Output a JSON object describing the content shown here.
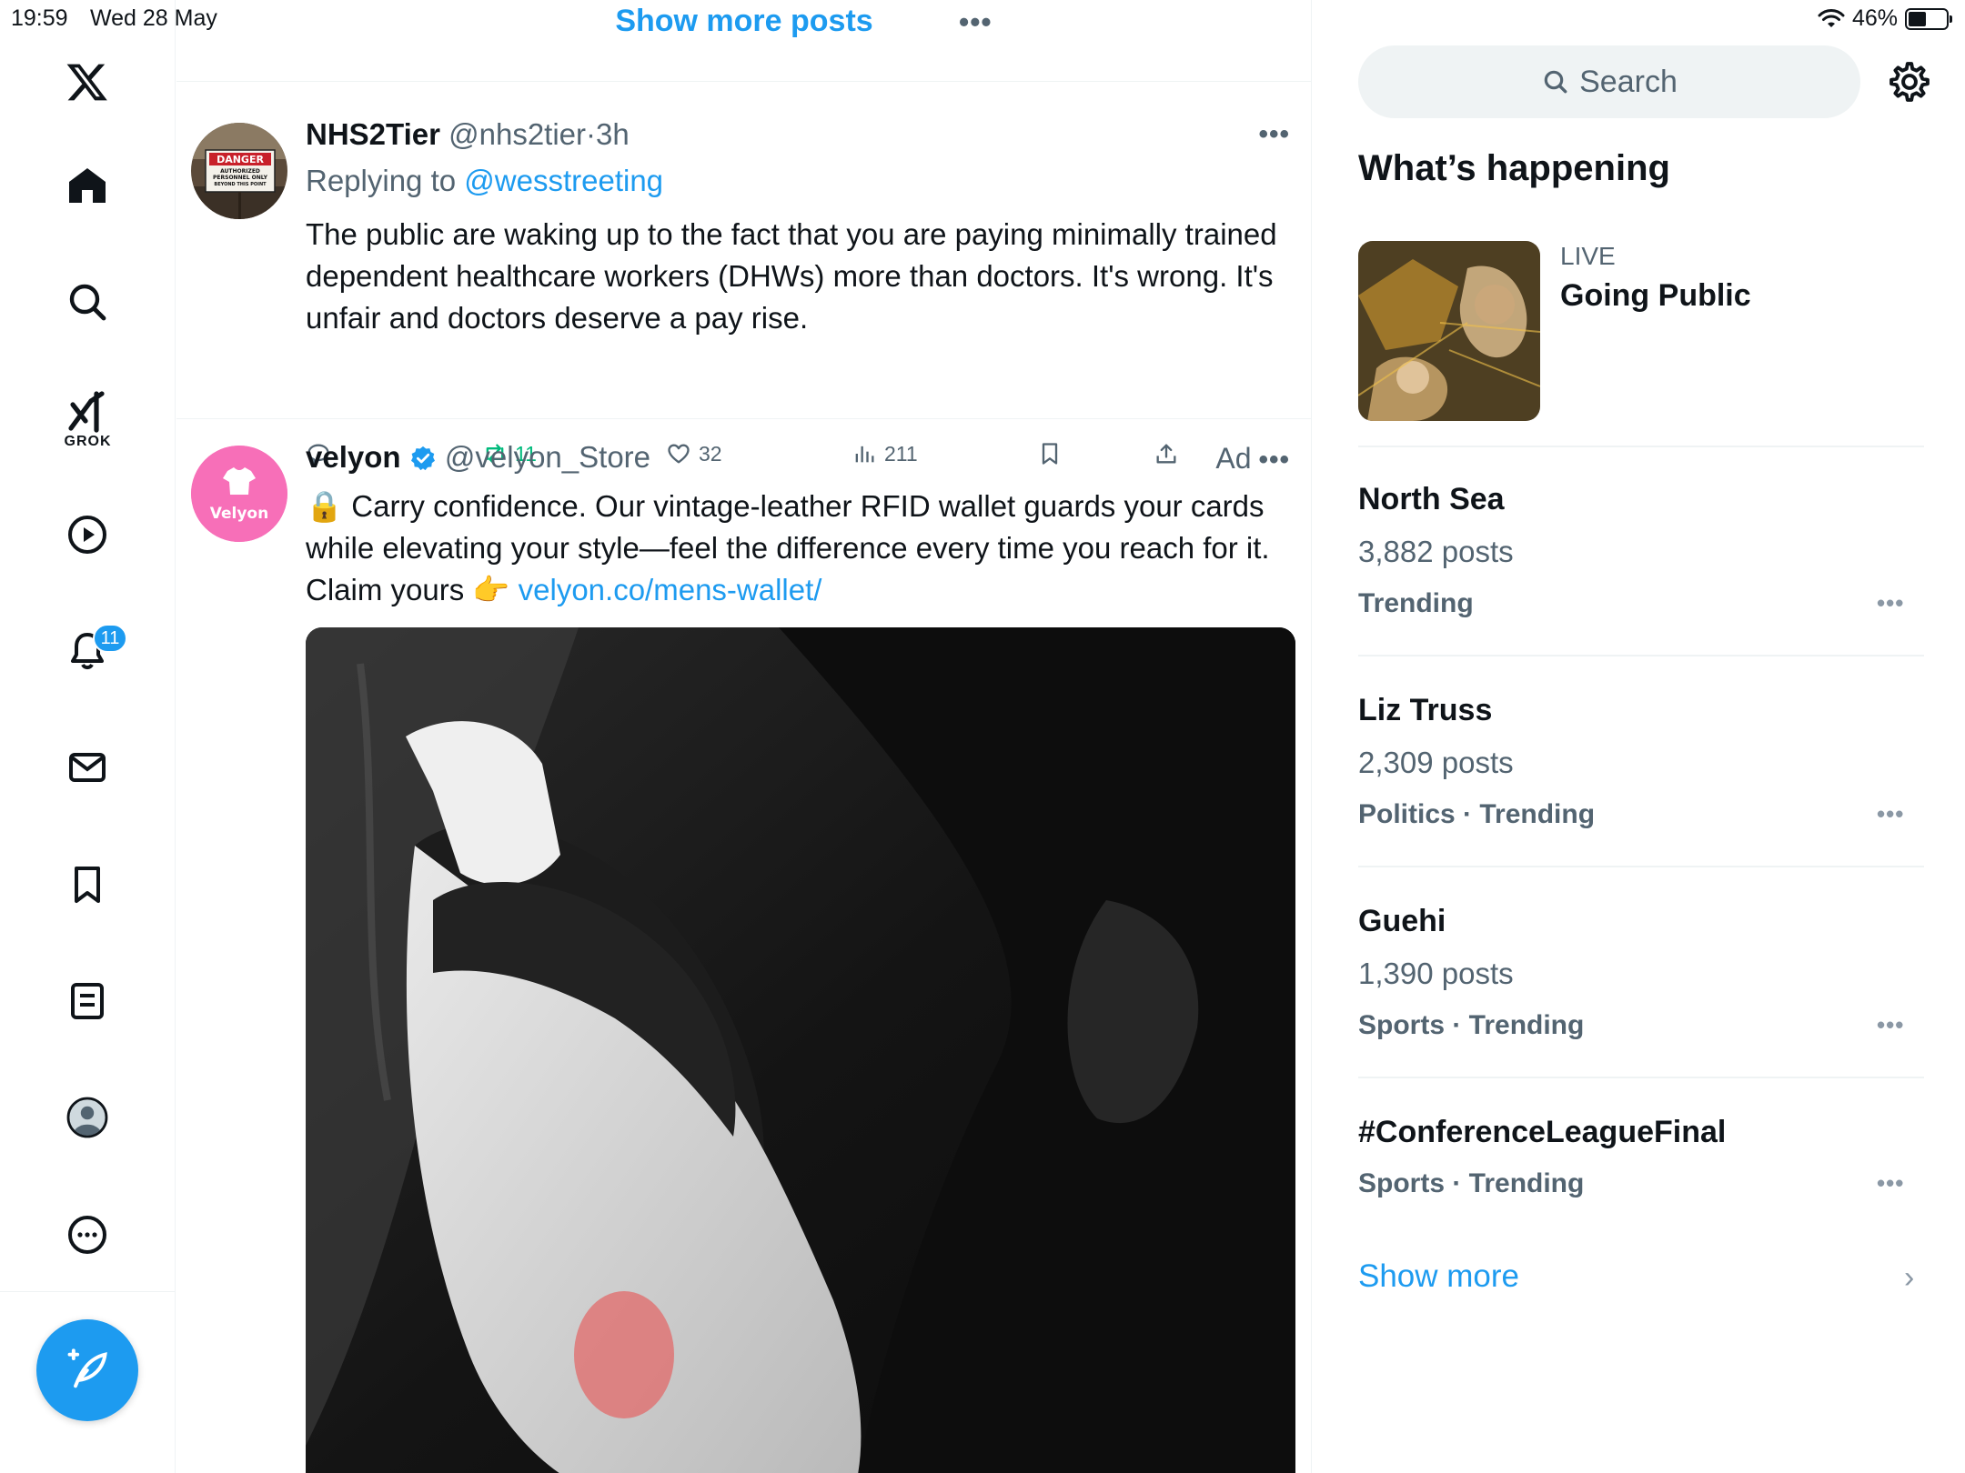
{
  "status_bar": {
    "time": "19:59",
    "date": "Wed 28 May",
    "battery": "46%",
    "battery_level": 0.46
  },
  "nav": {
    "logo": "x-logo-icon",
    "items": [
      "home-icon",
      "search-icon",
      "grok-icon",
      "video-icon",
      "notifications-icon",
      "messages-icon",
      "bookmarks-icon",
      "lists-icon",
      "profile-icon",
      "more-icon"
    ],
    "grok_label": "GROK",
    "notifications_badge": "11",
    "compose": "compose-icon"
  },
  "feed": {
    "show_more": "Show more posts",
    "top_menu": "•••",
    "tweet1": {
      "name": "NHS2Tier",
      "handle": "@nhs2tier",
      "sep": "·",
      "time": "3h",
      "menu": "•••",
      "replying_prefix": "Replying to ",
      "replying_to": "@wesstreeting",
      "text": "The public are waking up to the fact that you are paying minimally trained dependent healthcare workers (DHWs) more than doctors. It's wrong. It's unfair and doctors deserve a pay rise.",
      "retweets": "11",
      "likes": "32",
      "views": "211",
      "avatar_sign": {
        "line1": "DANGER",
        "line2": "AUTHORIZED",
        "line3": "PERSONNEL ONLY",
        "line4": "BEYOND THIS POINT"
      }
    },
    "tweet2": {
      "name": "velyon",
      "handle": "@velyon_Store",
      "ad_label": "Ad",
      "menu": "•••",
      "avatar_label": "Velyon",
      "text_main": "🔒 Carry confidence. Our vintage-leather RFID wallet guards your cards while elevating your style—feel the difference every time you reach for it. Claim yours 👉 ",
      "link": "velyon.co/mens-wallet/"
    }
  },
  "right": {
    "search_placeholder": "Search",
    "heading": "What’s happening",
    "live": {
      "tag": "LIVE",
      "title": "Going Public"
    },
    "trends": [
      {
        "title": "North Sea",
        "count": "3,882 posts",
        "category": "Trending"
      },
      {
        "title": "Liz Truss",
        "count": "2,309 posts",
        "category": "Politics · Trending"
      },
      {
        "title": "Guehi",
        "count": "1,390 posts",
        "category": "Sports · Trending"
      },
      {
        "title": "#ConferenceLeagueFinal",
        "count": "",
        "category": "Sports · Trending"
      }
    ],
    "trend_menu": "•••",
    "show_more": "Show more",
    "chevron": "›"
  },
  "colors": {
    "accent": "#1d9bf0",
    "retweet_green": "#00ba7c",
    "secondary": "#536471"
  }
}
